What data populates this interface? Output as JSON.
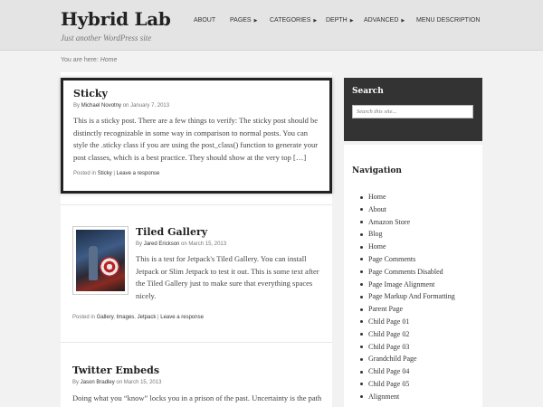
{
  "site": {
    "title": "Hybrid Lab",
    "description": "Just another WordPress site"
  },
  "nav": [
    {
      "label": "ABOUT",
      "has_submenu": false
    },
    {
      "label": "PAGES",
      "has_submenu": true
    },
    {
      "label": "CATEGORIES",
      "has_submenu": true
    },
    {
      "label": "DEPTH",
      "has_submenu": true
    },
    {
      "label": "ADVANCED",
      "has_submenu": true
    },
    {
      "label": "MENU DESCRIPTION",
      "has_submenu": false
    }
  ],
  "breadcrumb": {
    "prefix": "You are here:",
    "current": "Home"
  },
  "posts": {
    "sticky": {
      "title": "Sticky",
      "by": "By",
      "author": "Michael Novotny",
      "on": "on",
      "date": "January 7, 2013",
      "excerpt": "This is a sticky post. There are a few things to verify: The sticky post should be distinctly recognizable in some way in comparison to normal posts. You can style the .sticky class if you are using the post_class() function to generate your post classes, which is a best practice. They should show at the very top […]",
      "posted_in": "Posted in",
      "category": "Sticky",
      "separator": "|",
      "comment_link": "Leave a response"
    },
    "gallery": {
      "title": "Tiled Gallery",
      "by": "By",
      "author": "Jared Erickson",
      "on": "on",
      "date": "March 15, 2013",
      "excerpt": "This is a test for Jetpack's Tiled Gallery. You can install Jetpack or Slim Jetpack to test it out. This is some text after the Tiled Gallery just to make sure that everything spaces nicely.",
      "posted_in": "Posted in",
      "categories": [
        "Gallery",
        "Images",
        "Jetpack"
      ],
      "separator": "|",
      "comment_link": "Leave a response"
    },
    "twitter": {
      "title": "Twitter Embeds",
      "by": "By",
      "author": "Jason Bradley",
      "on": "on",
      "date": "March 15, 2013",
      "excerpt": "Doing what you “know” locks you in a prison of the past. Uncertainty is the path"
    }
  },
  "sidebar": {
    "search": {
      "title": "Search",
      "placeholder": "Search this site..."
    },
    "navigation": {
      "title": "Navigation",
      "items": [
        "Home",
        "About",
        "Amazon Store",
        "Blog",
        "Home",
        "Page Comments",
        "Page Comments Disabled",
        "Page Image Alignment",
        "Page Markup And Formatting",
        "Parent Page",
        "Child Page 01",
        "Child Page 02",
        "Child Page 03",
        "Grandchild Page",
        "Child Page 04",
        "Child Page 05",
        "Alignment"
      ]
    }
  }
}
